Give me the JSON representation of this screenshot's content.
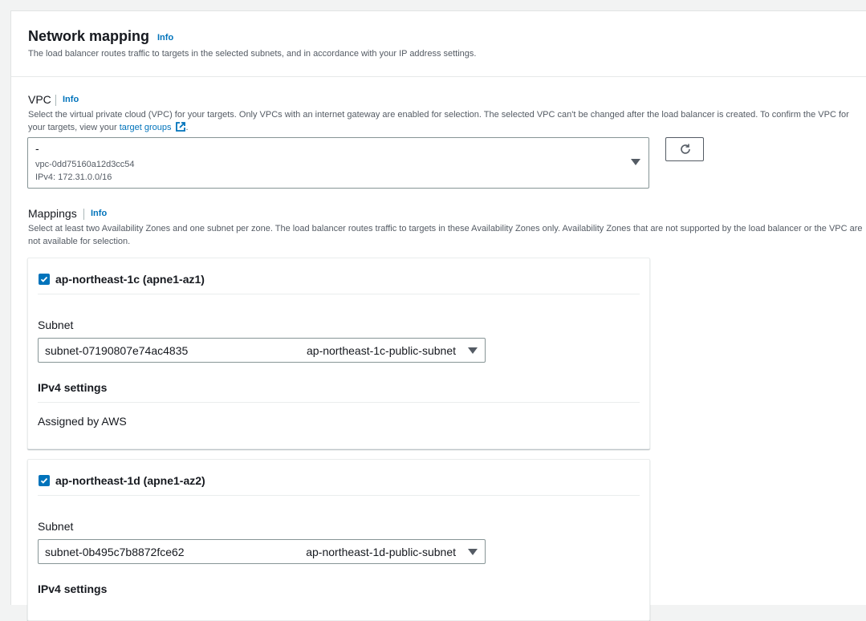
{
  "section": {
    "title": "Network mapping",
    "info": "Info",
    "description": "The load balancer routes traffic to targets in the selected subnets, and in accordance with your IP address settings."
  },
  "vpc": {
    "label": "VPC",
    "info": "Info",
    "description_pre": "Select the virtual private cloud (VPC) for your targets. Only VPCs with an internet gateway are enabled for selection. The selected VPC can't be changed after the load balancer is created. To confirm the VPC for your targets, view your ",
    "link_text": "target groups",
    "description_post": ".",
    "selected_name": "-",
    "selected_id": "vpc-0dd75160a12d3cc54",
    "selected_cidr": "IPv4: 172.31.0.0/16",
    "refresh_icon": "refresh-icon"
  },
  "mappings": {
    "label": "Mappings",
    "info": "Info",
    "description": "Select at least two Availability Zones and one subnet per zone. The load balancer routes traffic to targets in these Availability Zones only. Availability Zones that are not supported by the load balancer or the VPC are not available for selection.",
    "zones": [
      {
        "name": "ap-northeast-1c (apne1-az1)",
        "checked": true,
        "subnet_label": "Subnet",
        "subnet_id": "subnet-07190807e74ac4835",
        "subnet_name": "ap-northeast-1c-public-subnet",
        "ipv4_label": "IPv4 settings",
        "ipv4_value": "Assigned by AWS"
      },
      {
        "name": "ap-northeast-1d (apne1-az2)",
        "checked": true,
        "subnet_label": "Subnet",
        "subnet_id": "subnet-0b495c7b8872fce62",
        "subnet_name": "ap-northeast-1d-public-subnet",
        "ipv4_label": "IPv4 settings"
      }
    ]
  },
  "colors": {
    "link": "#0073bb",
    "text": "#16191f",
    "muted": "#545b64",
    "background": "#f2f3f3"
  }
}
